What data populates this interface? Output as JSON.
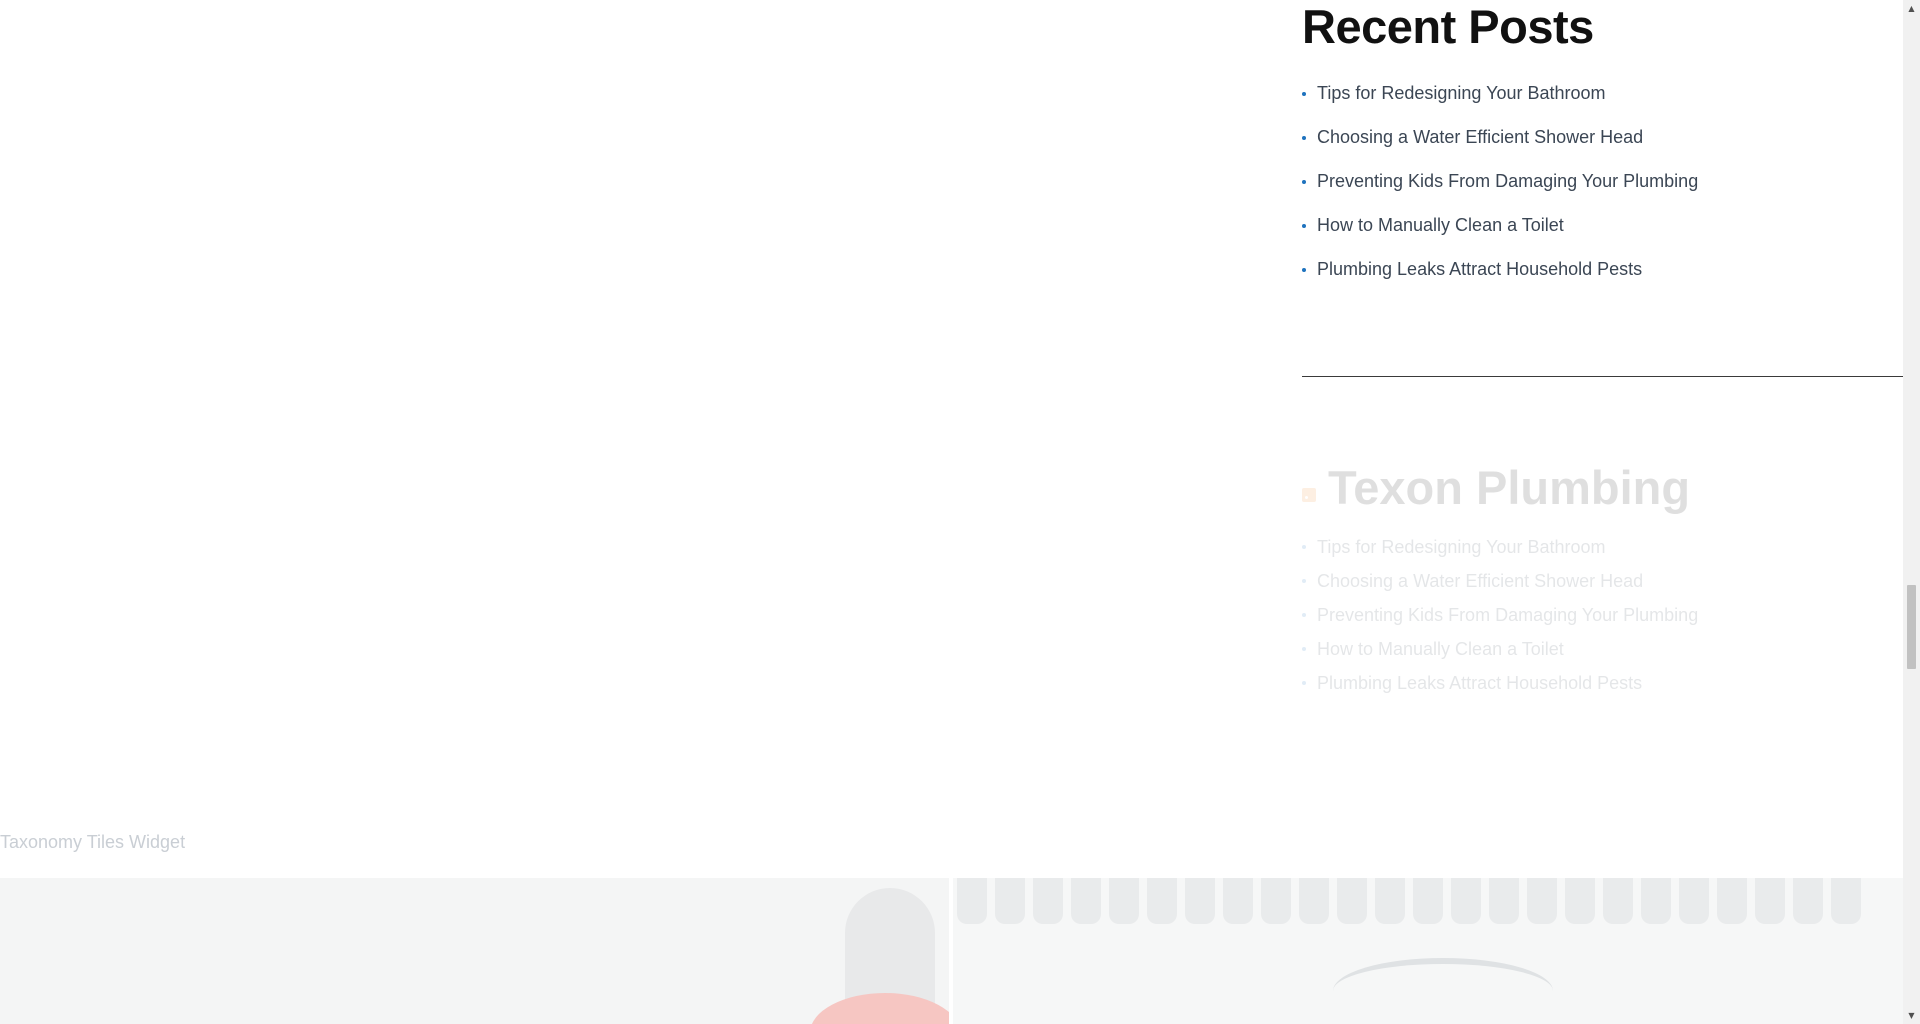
{
  "recent_posts": {
    "title": "Recent Posts",
    "items": [
      "Tips for Redesigning Your Bathroom",
      "Choosing a Water Efficient Shower Head",
      "Preventing Kids From Damaging Your Plumbing",
      "How to Manually Clean a Toilet",
      "Plumbing Leaks Attract Household Pests"
    ]
  },
  "rss": {
    "title": "Texon Plumbing",
    "icon": "rss-icon",
    "items": [
      "Tips for Redesigning Your Bathroom",
      "Choosing a Water Efficient Shower Head",
      "Preventing Kids From Damaging Your Plumbing",
      "How to Manually Clean a Toilet",
      "Plumbing Leaks Attract Household Pests"
    ]
  },
  "taxonomy": {
    "title": "Taxonomy Tiles Widget"
  },
  "scrollbar": {
    "up_arrow": "▲",
    "down_arrow": "▼"
  },
  "colors": {
    "bullet": "#1e73be",
    "heading": "#111111",
    "link": "#3b4654",
    "rss": "#f28b2b"
  }
}
